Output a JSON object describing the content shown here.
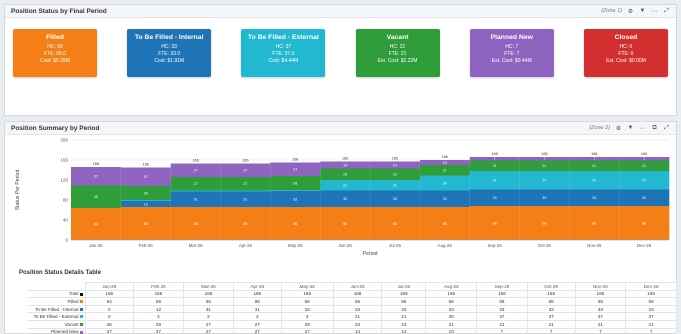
{
  "status_panel": {
    "title": "Position Status by Final Period",
    "zone": "(Zone 1)",
    "cards": [
      {
        "title": "Filled",
        "lines": [
          "HC: 69",
          "FTE: 68.0",
          "Cost: $6.39M"
        ],
        "color": "#f57f17"
      },
      {
        "title": "To Be Filled - Internal",
        "lines": [
          "HC: 33",
          "FTE: 33.0",
          "Cost: $1.91M"
        ],
        "color": "#1f73b7"
      },
      {
        "title": "To Be Filled - External",
        "lines": [
          "HC: 37",
          "FTE: 37.0",
          "Cost: $4.44M"
        ],
        "color": "#22b8cf"
      },
      {
        "title": "Vacant",
        "lines": [
          "HC: 21",
          "FTE: 21",
          "Est. Cost: $2.22M"
        ],
        "color": "#2e9d3a"
      },
      {
        "title": "Planned New",
        "lines": [
          "HC: 7",
          "FTE: 7",
          "Est. Cost: $0.44M"
        ],
        "color": "#8e64c0"
      },
      {
        "title": "Closed",
        "lines": [
          "HC: 0",
          "FTE: 0",
          "Est. Cost: $0.00M"
        ],
        "color": "#d32f2f"
      }
    ]
  },
  "summary_panel": {
    "title": "Position Summary by Period",
    "zone": "(Zone 2)"
  },
  "colors": {
    "filled": "#f57f17",
    "internal": "#1f73b7",
    "external": "#22b8cf",
    "vacant": "#2e9d3a",
    "planned": "#8e64c0"
  },
  "chart_data": {
    "type": "area",
    "stacked": true,
    "categories": [
      "Jan-26",
      "Feb-26",
      "Mar-26",
      "Apr-26",
      "May-26",
      "Jun-26",
      "Jul-26",
      "Aug-26",
      "Sep-26",
      "Oct-26",
      "Nov-26",
      "Dec-26"
    ],
    "series": [
      {
        "name": "Filled",
        "key": "filled",
        "values": [
          64,
          66,
          66,
          66,
          66,
          66,
          66,
          66,
          68,
          68,
          68,
          68
        ]
      },
      {
        "name": "To Be Filled - Internal",
        "key": "internal",
        "values": [
          0,
          12,
          31,
          31,
          32,
          33,
          33,
          33,
          33,
          33,
          33,
          33
        ]
      },
      {
        "name": "To Be Filled - External",
        "key": "external",
        "values": [
          0,
          2,
          2,
          2,
          2,
          21,
          21,
          30,
          37,
          37,
          37,
          37
        ]
      },
      {
        "name": "Vacant",
        "key": "vacant",
        "values": [
          45,
          28,
          27,
          27,
          28,
          23,
          23,
          21,
          21,
          21,
          21,
          21
        ]
      },
      {
        "name": "Planned New",
        "key": "planned",
        "values": [
          37,
          37,
          27,
          27,
          27,
          14,
          14,
          10,
          7,
          7,
          7,
          7
        ]
      }
    ],
    "totals": [
      "166",
      "166",
      "166",
      "166",
      "166",
      "166",
      "166",
      "166",
      "166",
      "166",
      "166",
      "166"
    ],
    "ylabel": "Status Per Period",
    "xlabel": "Period",
    "ylim": [
      0,
      200
    ],
    "yticks": [
      "0",
      "40",
      "80",
      "120",
      "160",
      "200"
    ],
    "grid": true,
    "legend": "none"
  },
  "details_table": {
    "title": "Position Status Details Table",
    "columns": [
      "Jan-26",
      "Feb-26",
      "Mar-26",
      "Apr-26",
      "May-26",
      "Jun-26",
      "Jul-26",
      "Aug-26",
      "Sep-26",
      "Oct-26",
      "Nov-26",
      "Dec-26"
    ],
    "rows": [
      {
        "label": "Total",
        "key": "total",
        "values": [
          "166",
          "166",
          "166",
          "166",
          "166",
          "166",
          "166",
          "166",
          "166",
          "166",
          "166",
          "166"
        ]
      },
      {
        "label": "Filled",
        "key": "filled",
        "values": [
          "64",
          "66",
          "66",
          "66",
          "66",
          "66",
          "66",
          "66",
          "68",
          "68",
          "68",
          "68"
        ]
      },
      {
        "label": "To Be Filled - Internal",
        "key": "internal",
        "values": [
          "0",
          "12",
          "31",
          "31",
          "32",
          "33",
          "33",
          "33",
          "33",
          "33",
          "33",
          "33"
        ]
      },
      {
        "label": "To Be Filled - External",
        "key": "external",
        "values": [
          "0",
          "2",
          "2",
          "2",
          "2",
          "21",
          "21",
          "30",
          "37",
          "37",
          "37",
          "37"
        ]
      },
      {
        "label": "Vacant",
        "key": "vacant",
        "values": [
          "45",
          "28",
          "27",
          "27",
          "28",
          "23",
          "23",
          "21",
          "21",
          "21",
          "21",
          "21"
        ]
      },
      {
        "label": "Planned New",
        "key": "planned",
        "values": [
          "37",
          "37",
          "27",
          "27",
          "27",
          "14",
          "14",
          "10",
          "7",
          "7",
          "7",
          "7"
        ]
      }
    ]
  }
}
